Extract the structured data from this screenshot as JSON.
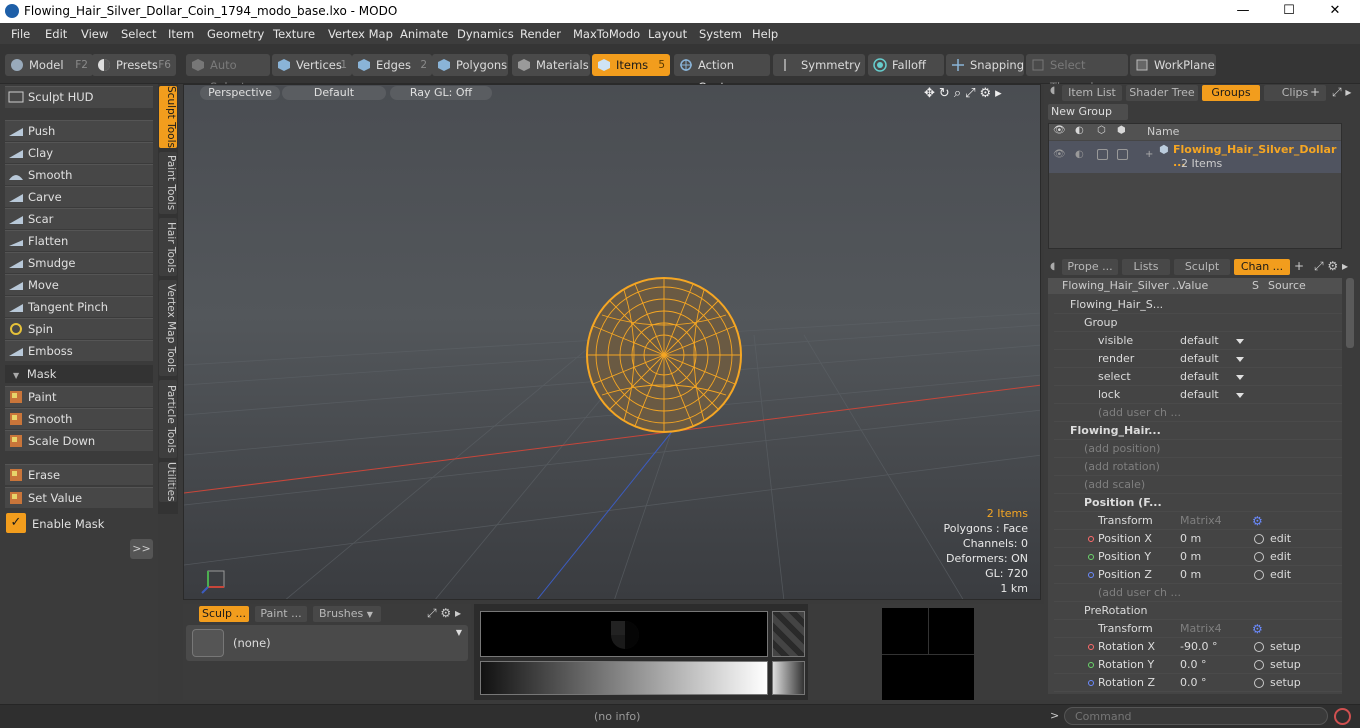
{
  "window": {
    "title": "Flowing_Hair_Silver_Dollar_Coin_1794_modo_base.lxo - MODO",
    "minimize": "—",
    "maximize": "☐",
    "close": "✕"
  },
  "menu": [
    "File",
    "Edit",
    "View",
    "Select",
    "Item",
    "Geometry",
    "Texture",
    "Vertex Map",
    "Animate",
    "Dynamics",
    "Render",
    "MaxToModo",
    "Layout",
    "System",
    "Help"
  ],
  "toolbar": {
    "model": "Model",
    "model_key": "F2",
    "presets": "Presets",
    "presets_key": "F6",
    "auto_select": "Auto Select",
    "vertices": "Vertices",
    "vertices_key": "1",
    "edges": "Edges",
    "edges_key": "2",
    "polygons": "Polygons",
    "materials": "Materials",
    "items": "Items",
    "items_key": "5",
    "action_center": "Action Center",
    "symmetry": "Symmetry",
    "falloff": "Falloff",
    "snapping": "Snapping",
    "select_through": "Select Through",
    "workplane": "WorkPlane"
  },
  "left": {
    "sculpt_hud": "Sculpt HUD",
    "tools": [
      "Push",
      "Clay",
      "Smooth",
      "Carve",
      "Scar",
      "Flatten",
      "Smudge",
      "Move",
      "Tangent Pinch",
      "Spin",
      "Emboss"
    ],
    "mask_header": "Mask",
    "mask_tools": [
      "Paint",
      "Smooth",
      "Scale Down"
    ],
    "erase": "Erase",
    "set_value": "Set Value",
    "enable_mask": "Enable Mask",
    "more": ">>"
  },
  "vtabs": [
    "Sculpt Tools",
    "Paint Tools",
    "Hair Tools",
    "Vertex Map Tools",
    "Particle Tools",
    "Utilities"
  ],
  "viewport": {
    "perspective": "Perspective",
    "default": "Default",
    "raygl": "Ray GL: Off",
    "info": {
      "items": "2 Items",
      "polygons": "Polygons : Face",
      "channels": "Channels: 0",
      "deformers": "Deformers: ON",
      "gl": "GL: 720",
      "scale": "1 km"
    }
  },
  "bottom": {
    "tabs": [
      "Sculp ...",
      "Paint ...",
      "Brushes"
    ],
    "brush_value": "(none)"
  },
  "right": {
    "top_tabs": [
      "Item List",
      "Shader Tree",
      "Groups",
      "Clips"
    ],
    "new_group": "New Group",
    "name_header": "Name",
    "group_name": "Flowing_Hair_Silver_Dollar ...",
    "group_count": "2 Items",
    "mid_tabs": [
      "Prope ...",
      "Lists",
      "Sculpt",
      "Chan ..."
    ],
    "ch_headers": {
      "name": "Flowing_Hair_Silver ...",
      "value": "Value",
      "s": "S",
      "source": "Source"
    },
    "channels": [
      {
        "label": "Flowing_Hair_S...",
        "value": "",
        "source": "",
        "indent": 1
      },
      {
        "label": "Group",
        "value": "",
        "source": "",
        "indent": 2
      },
      {
        "label": "visible",
        "value": "default",
        "source": "",
        "indent": 3
      },
      {
        "label": "render",
        "value": "default",
        "source": "",
        "indent": 3
      },
      {
        "label": "select",
        "value": "default",
        "source": "",
        "indent": 3
      },
      {
        "label": "lock",
        "value": "default",
        "source": "",
        "indent": 3
      },
      {
        "label": "(add user ch ...",
        "value": "",
        "source": "",
        "indent": 3
      },
      {
        "label": "Flowing_Hair...",
        "value": "",
        "source": "",
        "indent": 1
      },
      {
        "label": "(add position)",
        "value": "",
        "source": "",
        "indent": 2
      },
      {
        "label": "(add rotation)",
        "value": "",
        "source": "",
        "indent": 2
      },
      {
        "label": "(add scale)",
        "value": "",
        "source": "",
        "indent": 2
      },
      {
        "label": "Position (F...",
        "value": "",
        "source": "",
        "indent": 2
      },
      {
        "label": "Transform",
        "value": "Matrix4",
        "source": "",
        "indent": 3
      },
      {
        "label": "Position X",
        "value": "0 m",
        "source": "edit",
        "indent": 3
      },
      {
        "label": "Position Y",
        "value": "0 m",
        "source": "edit",
        "indent": 3
      },
      {
        "label": "Position Z",
        "value": "0 m",
        "source": "edit",
        "indent": 3
      },
      {
        "label": "(add user ch ...",
        "value": "",
        "source": "",
        "indent": 3
      },
      {
        "label": "PreRotation",
        "value": "",
        "source": "",
        "indent": 2
      },
      {
        "label": "Transform",
        "value": "Matrix4",
        "source": "",
        "indent": 3
      },
      {
        "label": "Rotation X",
        "value": "-90.0 °",
        "source": "setup",
        "indent": 3
      },
      {
        "label": "Rotation Y",
        "value": "0.0 °",
        "source": "setup",
        "indent": 3
      },
      {
        "label": "Rotation Z",
        "value": "0.0 °",
        "source": "setup",
        "indent": 3
      }
    ]
  },
  "status": {
    "info": "(no info)",
    "command_placeholder": "Command"
  },
  "colors": {
    "accent": "#f29d1d",
    "wire": "#f5a623"
  }
}
